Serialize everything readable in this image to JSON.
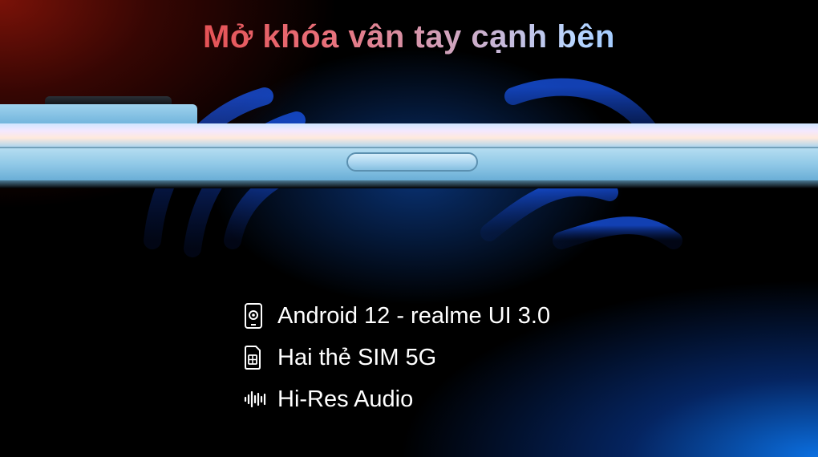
{
  "headline": "Mở khóa vân tay cạnh bên",
  "features": [
    {
      "icon": "phone-settings-icon",
      "label": "Android 12 - realme UI 3.0"
    },
    {
      "icon": "sim-card-icon",
      "label": "Hai thẻ SIM 5G"
    },
    {
      "icon": "audio-waveform-icon",
      "label": "Hi-Res Audio"
    }
  ],
  "colors": {
    "headline_start": "#e0221a",
    "headline_end": "#3f9cff",
    "phone_body": "#8ec7e6",
    "background": "#000000",
    "glow_blue": "#0b6fe0",
    "glow_red": "#7a1208"
  }
}
